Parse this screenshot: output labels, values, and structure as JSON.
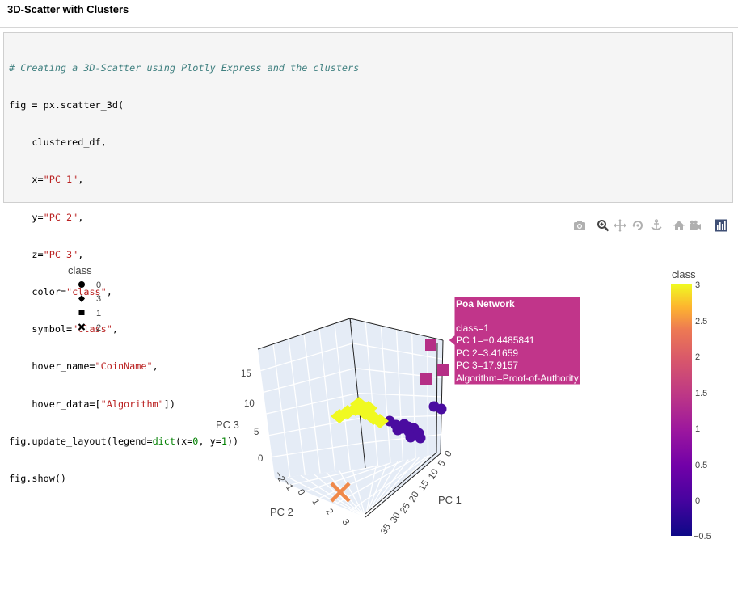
{
  "page": {
    "title": "3D-Scatter with Clusters"
  },
  "code": {
    "lines": [
      "# Creating a 3D-Scatter using Plotly Express and the clusters",
      "fig = px.scatter_3d(",
      "    clustered_df,",
      "    x=\"PC 1\",",
      "    y=\"PC 2\",",
      "    z=\"PC 3\",",
      "    color=\"class\",",
      "    symbol=\"class\",",
      "    hover_name=\"CoinName\",",
      "    hover_data=[\"Algorithm\"])",
      "fig.update_layout(legend=dict(x=0, y=1))",
      "fig.show()"
    ]
  },
  "modebar": {
    "icons": [
      "camera-icon",
      "zoom-icon",
      "pan-icon",
      "orbit-rotation-icon",
      "turntable-rotation-icon",
      "home-icon",
      "camera-view-icon",
      "plotly-logo-icon"
    ]
  },
  "colors": {
    "class_0": "#4a0ca0",
    "class_1": "#b52f86",
    "class_2": "#f0894a",
    "class_3": "#f0f921",
    "hover_bg": "#c1358a",
    "scene_bg": "#e5ecf6"
  },
  "chart_data": {
    "type": "scatter3d",
    "legend": {
      "title": "class",
      "entries": [
        {
          "label": "0",
          "symbol": "circle"
        },
        {
          "label": "3",
          "symbol": "diamond"
        },
        {
          "label": "1",
          "symbol": "square"
        },
        {
          "label": "2",
          "symbol": "x"
        }
      ]
    },
    "axes": {
      "x": {
        "title": "PC 1",
        "ticks": [
          "0",
          "5",
          "10",
          "15",
          "20",
          "25",
          "30",
          "35"
        ]
      },
      "y": {
        "title": "PC 2",
        "ticks": [
          "−2",
          "−1",
          "0",
          "1",
          "2",
          "3"
        ]
      },
      "z": {
        "title": "PC 3",
        "ticks": [
          "0",
          "5",
          "10",
          "15"
        ]
      }
    },
    "colorbar": {
      "title": "class",
      "ticks": [
        "3",
        "2.5",
        "2",
        "1.5",
        "1",
        "0.5",
        "0",
        "−0.5"
      ],
      "range": [
        -0.5,
        3
      ]
    },
    "series": [
      {
        "class": 0,
        "symbol": "circle",
        "points": [
          [
            -0.3,
            -0.6,
            0.6
          ],
          [
            -0.2,
            -0.4,
            0.4
          ],
          [
            0.0,
            -0.2,
            0.2
          ],
          [
            0.2,
            0.0,
            0.1
          ],
          [
            0.4,
            0.2,
            0.0
          ],
          [
            0.6,
            0.5,
            -0.1
          ],
          [
            0.8,
            0.8,
            -0.2
          ],
          [
            1.0,
            1.1,
            -0.3
          ],
          [
            0.3,
            0.4,
            0.3
          ],
          [
            -0.1,
            0.1,
            0.5
          ],
          [
            0.5,
            0.9,
            0.2
          ],
          [
            0.7,
            1.2,
            0.0
          ],
          [
            -0.4,
            2.6,
            5.5
          ],
          [
            -0.3,
            2.8,
            5.2
          ]
        ]
      },
      {
        "class": 3,
        "symbol": "diamond",
        "points": [
          [
            -0.5,
            -1.6,
            0.8
          ],
          [
            -0.4,
            -1.4,
            1.0
          ],
          [
            -0.3,
            -1.2,
            0.9
          ],
          [
            -0.2,
            -1.0,
            0.7
          ],
          [
            -0.1,
            -0.8,
            0.6
          ],
          [
            0.0,
            -0.7,
            0.5
          ],
          [
            -0.6,
            -1.9,
            0.6
          ],
          [
            -0.2,
            -1.3,
            1.2
          ]
        ]
      },
      {
        "class": 1,
        "symbol": "square",
        "points": [
          [
            -0.4,
            3.4,
            17.9
          ],
          [
            -0.5,
            2.2,
            16.4
          ],
          [
            -0.3,
            3.9,
            14.2
          ]
        ]
      },
      {
        "class": 2,
        "symbol": "x",
        "points": [
          [
            34.0,
            1.3,
            0.1
          ]
        ]
      }
    ],
    "hover": {
      "name": "Poa Network",
      "lines": [
        "class=1",
        "PC 1=−0.4485841",
        "PC 2=3.41659",
        "PC 3=17.9157",
        "Algorithm=Proof-of-Authority"
      ]
    }
  }
}
